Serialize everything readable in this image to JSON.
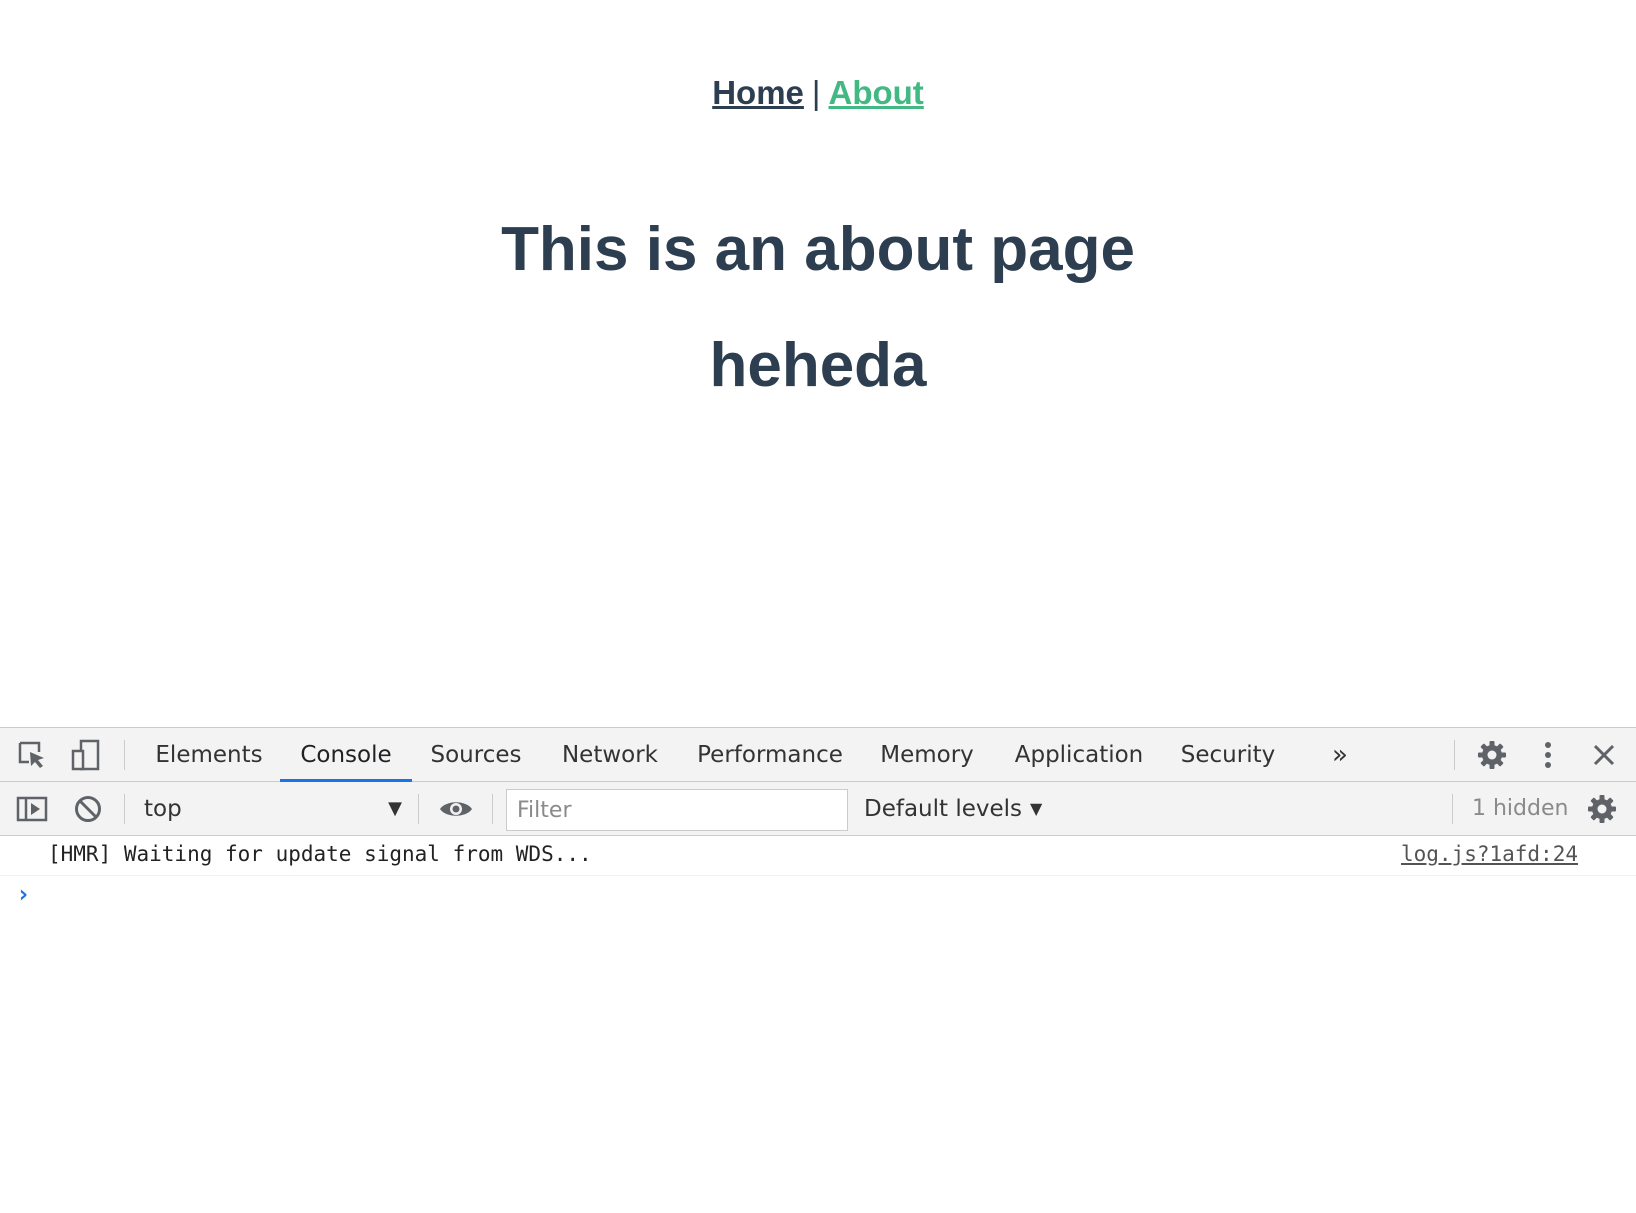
{
  "page": {
    "nav": {
      "home_label": "Home",
      "separator": "|",
      "about_label": "About"
    },
    "heading_1": "This is an about page",
    "heading_2": "heheda"
  },
  "devtools": {
    "tabs": [
      {
        "label": "Elements",
        "active": false
      },
      {
        "label": "Console",
        "active": true
      },
      {
        "label": "Sources",
        "active": false
      },
      {
        "label": "Network",
        "active": false
      },
      {
        "label": "Performance",
        "active": false
      },
      {
        "label": "Memory",
        "active": false
      },
      {
        "label": "Application",
        "active": false
      },
      {
        "label": "Security",
        "active": false
      }
    ],
    "more_tabs_icon": "chevron-double-right-icon",
    "toolbar": {
      "context_value": "top",
      "filter_placeholder": "Filter",
      "levels_label": "Default levels",
      "hidden_count": "1 hidden"
    },
    "console": {
      "messages": [
        {
          "text": "[HMR] Waiting for update signal from WDS...",
          "source": "log.js?1afd:24"
        }
      ]
    }
  },
  "colors": {
    "text": "#2c3e50",
    "active_link": "#42b983",
    "devtools_bg": "#f3f3f3",
    "active_tab_underline": "#1a73e8"
  }
}
